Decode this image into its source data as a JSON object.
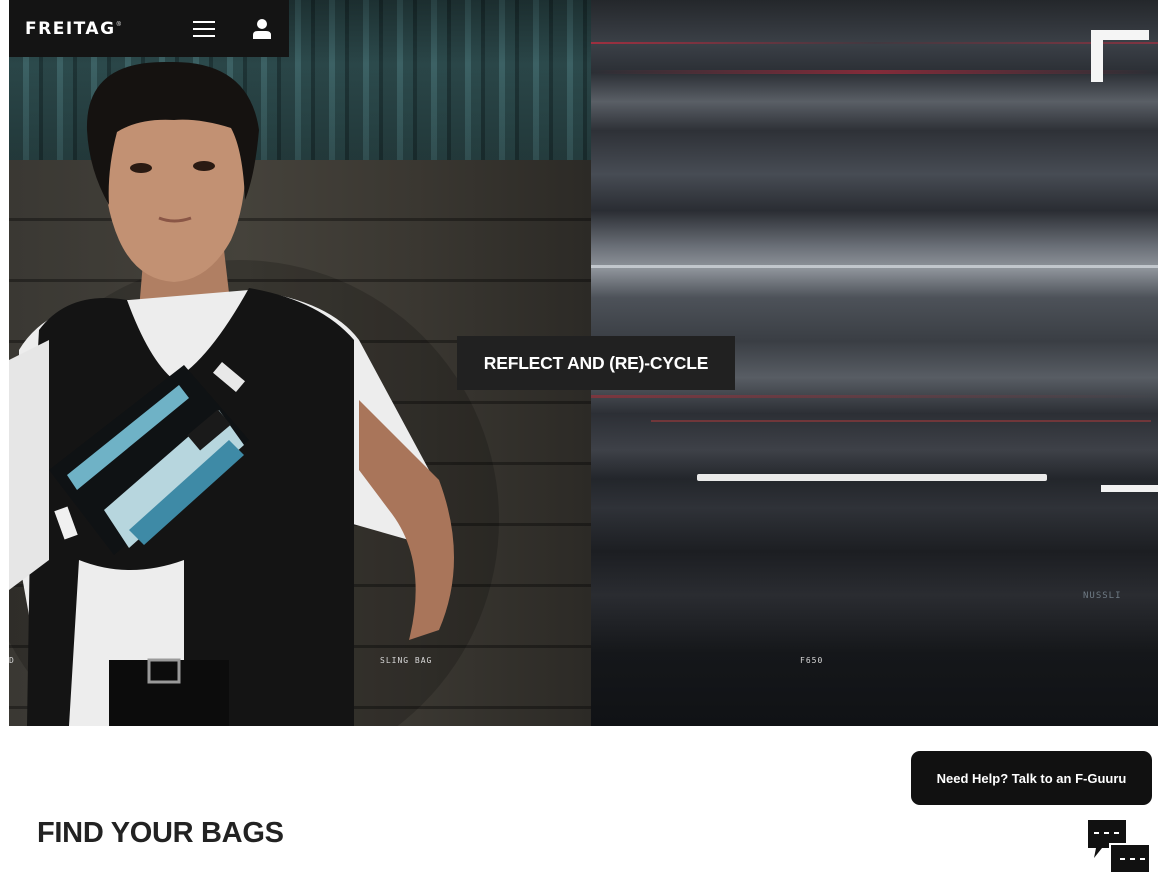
{
  "header": {
    "logo_text": "FREITAG",
    "logo_mark": "®",
    "menu_icon": "hamburger-menu-icon",
    "account_icon": "user-icon"
  },
  "hero": {
    "campaign_label": "REFLECT AND (RE)-CYCLE",
    "captions": [
      "D",
      "SLING BAG",
      "F650"
    ],
    "sign_text": "NUSSLI"
  },
  "main": {
    "section_title": "FIND YOUR BAGS"
  },
  "chat": {
    "help_text": "Need Help? Talk to an F-Guuru",
    "chat_icon": "chat-bubbles-icon"
  }
}
